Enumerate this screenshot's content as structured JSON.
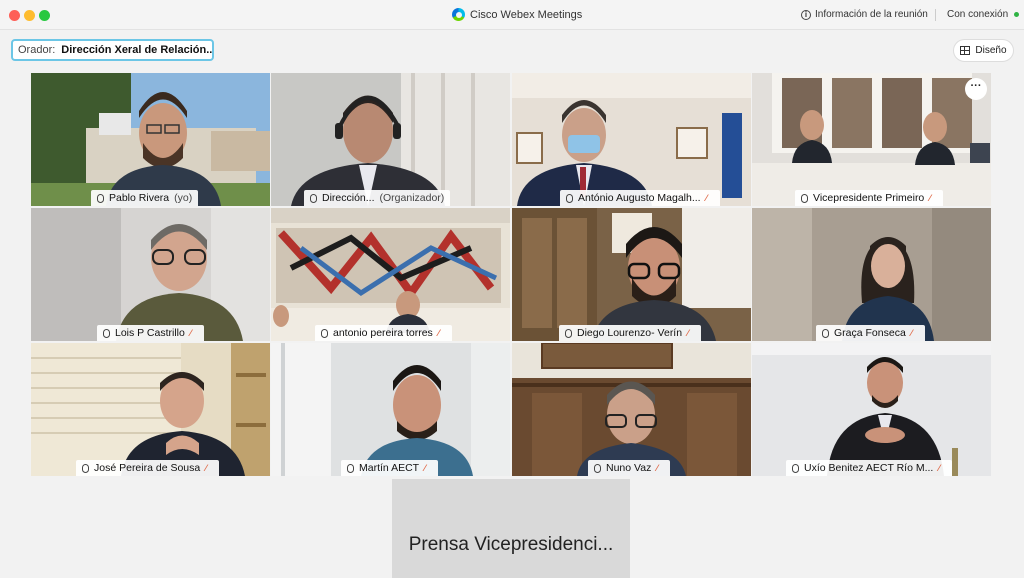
{
  "window": {
    "app_title": "Cisco Webex Meetings",
    "meeting_info_label": "Información de la reunión",
    "connection_label": "Con conexión"
  },
  "toolbar": {
    "speaker_label": "Orador:",
    "speaker_name": "Dirección Xeral de Relación...",
    "layout_label": "Diseño"
  },
  "participants": [
    {
      "name": "Pablo Rivera",
      "suffix": "(yo)",
      "muted": false
    },
    {
      "name": "Dirección...",
      "suffix": "(Organizador)",
      "muted": false,
      "active": true
    },
    {
      "name": "António Augusto Magalh...",
      "suffix": "",
      "muted": true
    },
    {
      "name": "Vicepresidente Primeiro",
      "suffix": "",
      "muted": true
    },
    {
      "name": "Lois P Castrillo",
      "suffix": "",
      "muted": true
    },
    {
      "name": "antonio pereira torres",
      "suffix": "",
      "muted": true
    },
    {
      "name": "Diego Lourenzo- Verín",
      "suffix": "",
      "muted": true
    },
    {
      "name": "Graça Fonseca",
      "suffix": "",
      "muted": true
    },
    {
      "name": "José Pereira de Sousa",
      "suffix": "",
      "muted": true
    },
    {
      "name": "Martín AECT",
      "suffix": "",
      "muted": true
    },
    {
      "name": "Nuno Vaz",
      "suffix": "",
      "muted": true
    },
    {
      "name": "Uxío Benitez AECT Río M...",
      "suffix": "",
      "muted": true
    }
  ],
  "more_options_label": "···",
  "presenter": {
    "name": "Prensa Vicepresidenci..."
  },
  "colors": {
    "active_border": "#5ec3e8",
    "muted_icon": "#e06b4a",
    "connected": "#2fb344"
  }
}
